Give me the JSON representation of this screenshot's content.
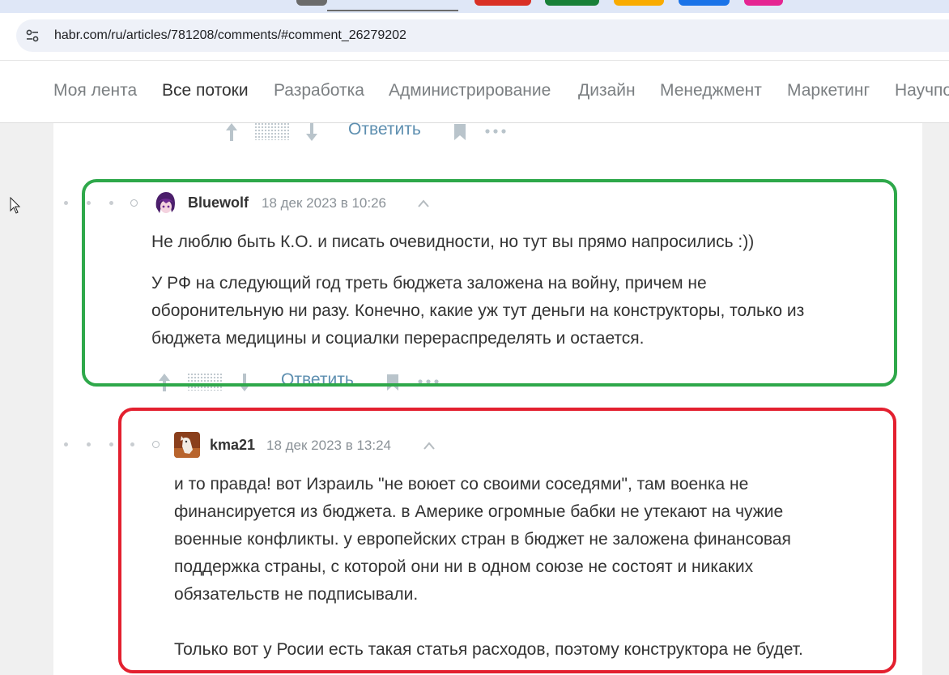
{
  "browser": {
    "url": "habr.com/ru/articles/781208/comments/#comment_26279202",
    "site_info_icon": "tune-icon"
  },
  "nav": {
    "items": [
      "Моя лента",
      "Все потоки",
      "Разработка",
      "Администрирование",
      "Дизайн",
      "Менеджмент",
      "Маркетинг",
      "Научпоп"
    ],
    "active": "Все потоки"
  },
  "comments": [
    {
      "actions": {
        "reply_label": "Ответить"
      }
    },
    {
      "author": "Bluewolf",
      "date": "18 дек 2023 в 10:26",
      "paragraphs": [
        [
          "Не люблю быть К.О. и писать очевидности, но тут вы прямо напросились :))"
        ],
        [
          "У РФ на следующий год треть бюджета заложена на войну, причем не",
          "оборонительную ни разу. Конечно, какие уж тут деньги на конструкторы, только из",
          "бюджета медицины и социалки перераспределять и остается."
        ]
      ],
      "actions": {
        "reply_label": "Ответить"
      },
      "highlight": "green"
    },
    {
      "author": "kma21",
      "date": "18 дек 2023 в 13:24",
      "paragraphs": [
        [
          "и то правда! вот Израиль \"не воюет со своими соседями\", там военка не",
          "финансируется из бюджета. в Америке огромные бабки не утекают на чужие",
          "военные конфликты. у европейских стран в бюджет не заложена финансовая",
          "поддержка страны, с которой они ни в одном союзе не состоят и никаких",
          "обязательств не подписывали."
        ],
        [
          "Только вот у Росии есть такая статья расходов, поэтому конструктора не будет."
        ]
      ],
      "highlight": "red"
    }
  ],
  "colors": {
    "highlight_green": "#2ea84a",
    "highlight_red": "#e3202f",
    "link": "#5e8fb0"
  }
}
